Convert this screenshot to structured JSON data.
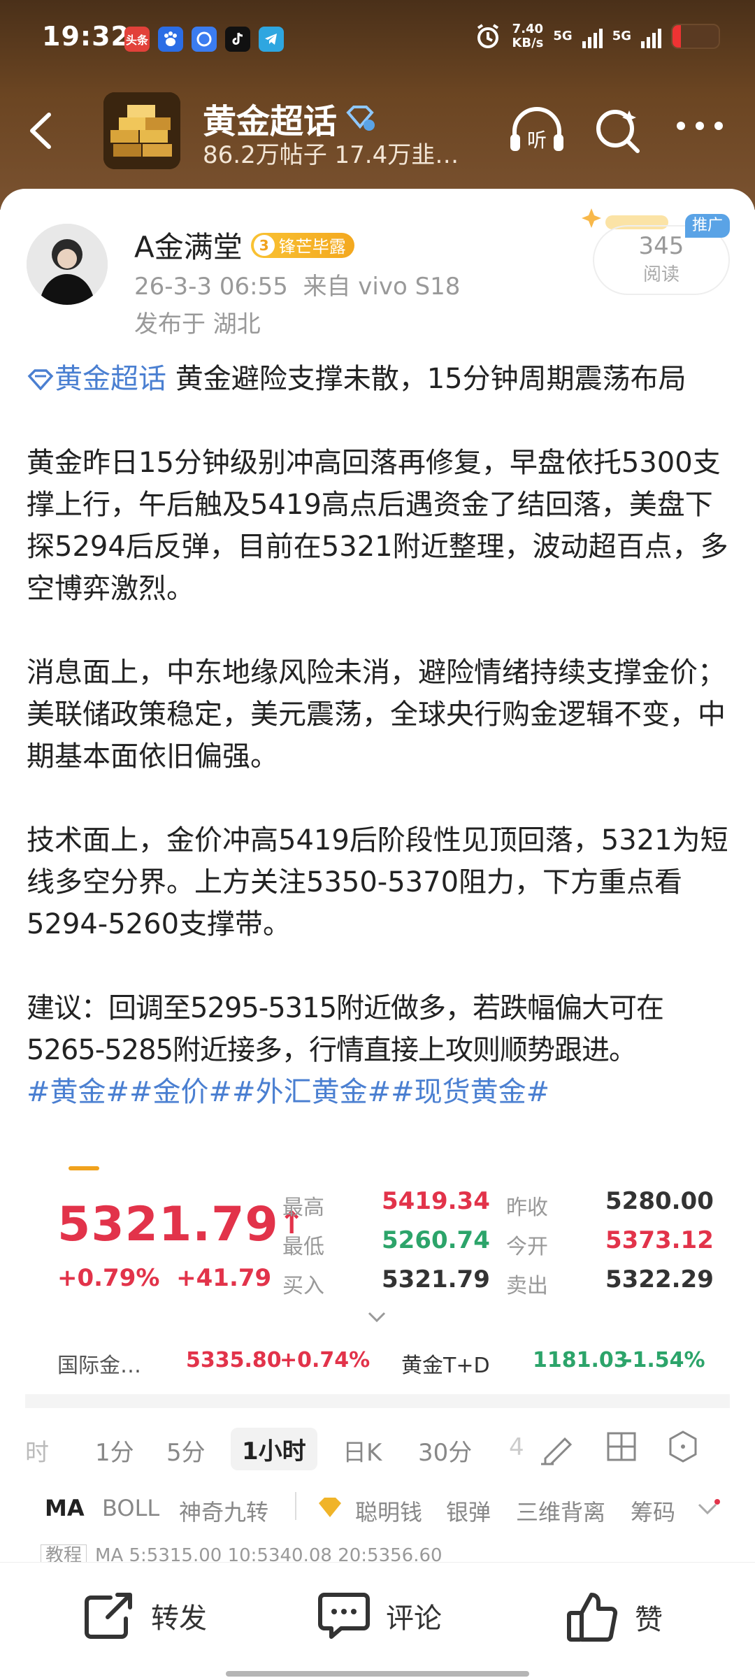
{
  "status_bar": {
    "time": "19:32",
    "net_speed_value": "7.40",
    "net_speed_unit": "KB/s",
    "sim1": "5G",
    "sim2": "5G",
    "app_icons": [
      "toutiao-icon",
      "baidu-icon",
      "browser-icon",
      "tiktok-icon",
      "telegram-icon"
    ],
    "toutiao_label": "头条"
  },
  "nav": {
    "group_title": "黄金超话",
    "group_subtitle": "86.2万帖子 17.4万韭…",
    "listen_label": "听"
  },
  "post": {
    "author": "A金满堂",
    "badge_level": "3",
    "badge_label": "锋芒毕露",
    "date": "26-3-3 06:55",
    "source": "来自 vivo S18",
    "location": "发布于 湖北",
    "read_count": "345",
    "read_label": "阅读",
    "promo_label": "推广",
    "topic_link": "黄金超话",
    "title_text": " 黄金避险支撑未散，15分钟周期震荡布局",
    "paragraphs": [
      "黄金昨日15分钟级别冲高回落再修复，早盘依托5300支撑上行，午后触及5419高点后遇资金了结回落，美盘下探5294后反弹，目前在5321附近整理，波动超百点，多空博弈激烈。",
      "消息面上，中东地缘风险未消，避险情绪持续支撑金价；美联储政策稳定，美元震荡，全球央行购金逻辑不变，中期基本面依旧偏强。",
      "技术面上，金价冲高5419后阶段性见顶回落，5321为短线多空分界。上方关注5350-5370阻力，下方重点看5294-5260支撑带。"
    ],
    "advice": "建议：回调至5295-5315附近做多，若跌幅偏大可在5265-5285附近接多，行情直接上攻则顺势跟进。",
    "tags": "#黄金##金价##外汇黄金##现货黄金#"
  },
  "quote": {
    "price": "5321.79",
    "up_arrow": "↑",
    "change_pct": "+0.79%",
    "change_abs": "+41.79",
    "high_label": "最高",
    "high": "5419.34",
    "low_label": "最低",
    "low": "5260.74",
    "bid_label": "买入",
    "bid": "5321.79",
    "prev_close_label": "昨收",
    "prev_close": "5280.00",
    "open_label": "今开",
    "open": "5373.12",
    "ask_label": "卖出",
    "ask": "5322.29",
    "ticker1_name": "国际金…",
    "ticker1_price": "5335.80",
    "ticker1_pct": "+0.74%",
    "ticker2_name": "黄金T+D",
    "ticker2_price": "1181.03",
    "ticker2_pct": "-1.54%",
    "timeframes": [
      "时",
      "1分",
      "5分",
      "1小时",
      "日K",
      "30分",
      "4"
    ],
    "active_timeframe": "1小时",
    "indicators": [
      "MA",
      "BOLL",
      "神奇九转",
      "聪明钱",
      "银弹",
      "三维背离",
      "筹码"
    ],
    "ma_strip_tag": "教程",
    "ma_strip": "MA 5:5315.00  10:5340.08  20:5356.60"
  },
  "bottom_bar": {
    "repost": "转发",
    "comment": "评论",
    "like": "赞"
  },
  "colors": {
    "header_brown": "#6b4522",
    "up_red": "#e2334a",
    "down_green": "#2ca46a",
    "link_blue": "#4a7fd1",
    "badge_gold": "#f3a81f"
  }
}
